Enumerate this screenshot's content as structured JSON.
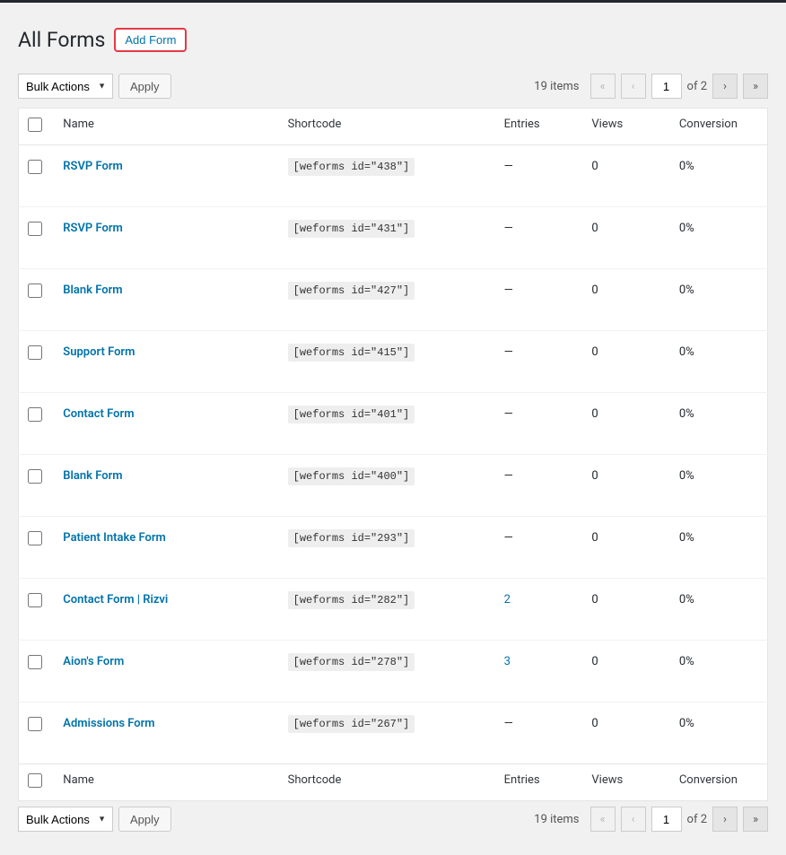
{
  "header": {
    "title": "All Forms",
    "add_button": "Add Form"
  },
  "bulk": {
    "label": "Bulk Actions",
    "apply": "Apply"
  },
  "pagination": {
    "items_text": "19 items",
    "first": "«",
    "prev": "‹",
    "current": "1",
    "of_text": "of 2",
    "next": "›",
    "last": "»"
  },
  "columns": {
    "name": "Name",
    "shortcode": "Shortcode",
    "entries": "Entries",
    "views": "Views",
    "conversion": "Conversion"
  },
  "rows": [
    {
      "name": "RSVP Form",
      "shortcode": "[weforms id=\"438\"]",
      "entries": "—",
      "entries_link": false,
      "views": "0",
      "conversion": "0%"
    },
    {
      "name": "RSVP Form",
      "shortcode": "[weforms id=\"431\"]",
      "entries": "—",
      "entries_link": false,
      "views": "0",
      "conversion": "0%"
    },
    {
      "name": "Blank Form",
      "shortcode": "[weforms id=\"427\"]",
      "entries": "—",
      "entries_link": false,
      "views": "0",
      "conversion": "0%"
    },
    {
      "name": "Support Form",
      "shortcode": "[weforms id=\"415\"]",
      "entries": "—",
      "entries_link": false,
      "views": "0",
      "conversion": "0%"
    },
    {
      "name": "Contact Form",
      "shortcode": "[weforms id=\"401\"]",
      "entries": "—",
      "entries_link": false,
      "views": "0",
      "conversion": "0%"
    },
    {
      "name": "Blank Form",
      "shortcode": "[weforms id=\"400\"]",
      "entries": "—",
      "entries_link": false,
      "views": "0",
      "conversion": "0%"
    },
    {
      "name": "Patient Intake Form",
      "shortcode": "[weforms id=\"293\"]",
      "entries": "—",
      "entries_link": false,
      "views": "0",
      "conversion": "0%"
    },
    {
      "name": "Contact Form | Rizvi",
      "shortcode": "[weforms id=\"282\"]",
      "entries": "2",
      "entries_link": true,
      "views": "0",
      "conversion": "0%"
    },
    {
      "name": "Aion's Form",
      "shortcode": "[weforms id=\"278\"]",
      "entries": "3",
      "entries_link": true,
      "views": "0",
      "conversion": "0%"
    },
    {
      "name": "Admissions Form",
      "shortcode": "[weforms id=\"267\"]",
      "entries": "—",
      "entries_link": false,
      "views": "0",
      "conversion": "0%"
    }
  ]
}
